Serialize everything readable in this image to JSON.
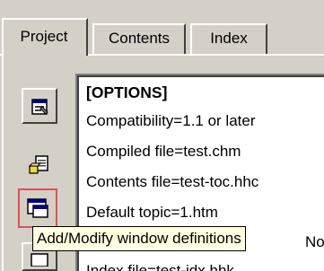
{
  "tabs": [
    {
      "label": "Project",
      "active": true
    },
    {
      "label": "Contents",
      "active": false
    },
    {
      "label": "Index",
      "active": false
    }
  ],
  "toolbar": {
    "buttons": [
      {
        "icon": "options-icon"
      },
      {
        "icon": "add-files-icon"
      },
      {
        "icon": "window-definitions-icon",
        "highlighted": true
      },
      {
        "icon": "toolbar-button-icon"
      }
    ]
  },
  "editor": {
    "lines": [
      "[OPTIONS]",
      "Compatibility=1.1 or later",
      "Compiled file=test.chm",
      "Contents file=test-toc.hhc",
      "Default topic=1.htm",
      "No",
      "Index file=test-idx.hhk"
    ]
  },
  "tooltip": {
    "text": "Add/Modify window definitions"
  },
  "colors": {
    "face": "#d4d0c8",
    "tooltip_bg": "#ffffe1",
    "highlight_border": "#e05050"
  }
}
